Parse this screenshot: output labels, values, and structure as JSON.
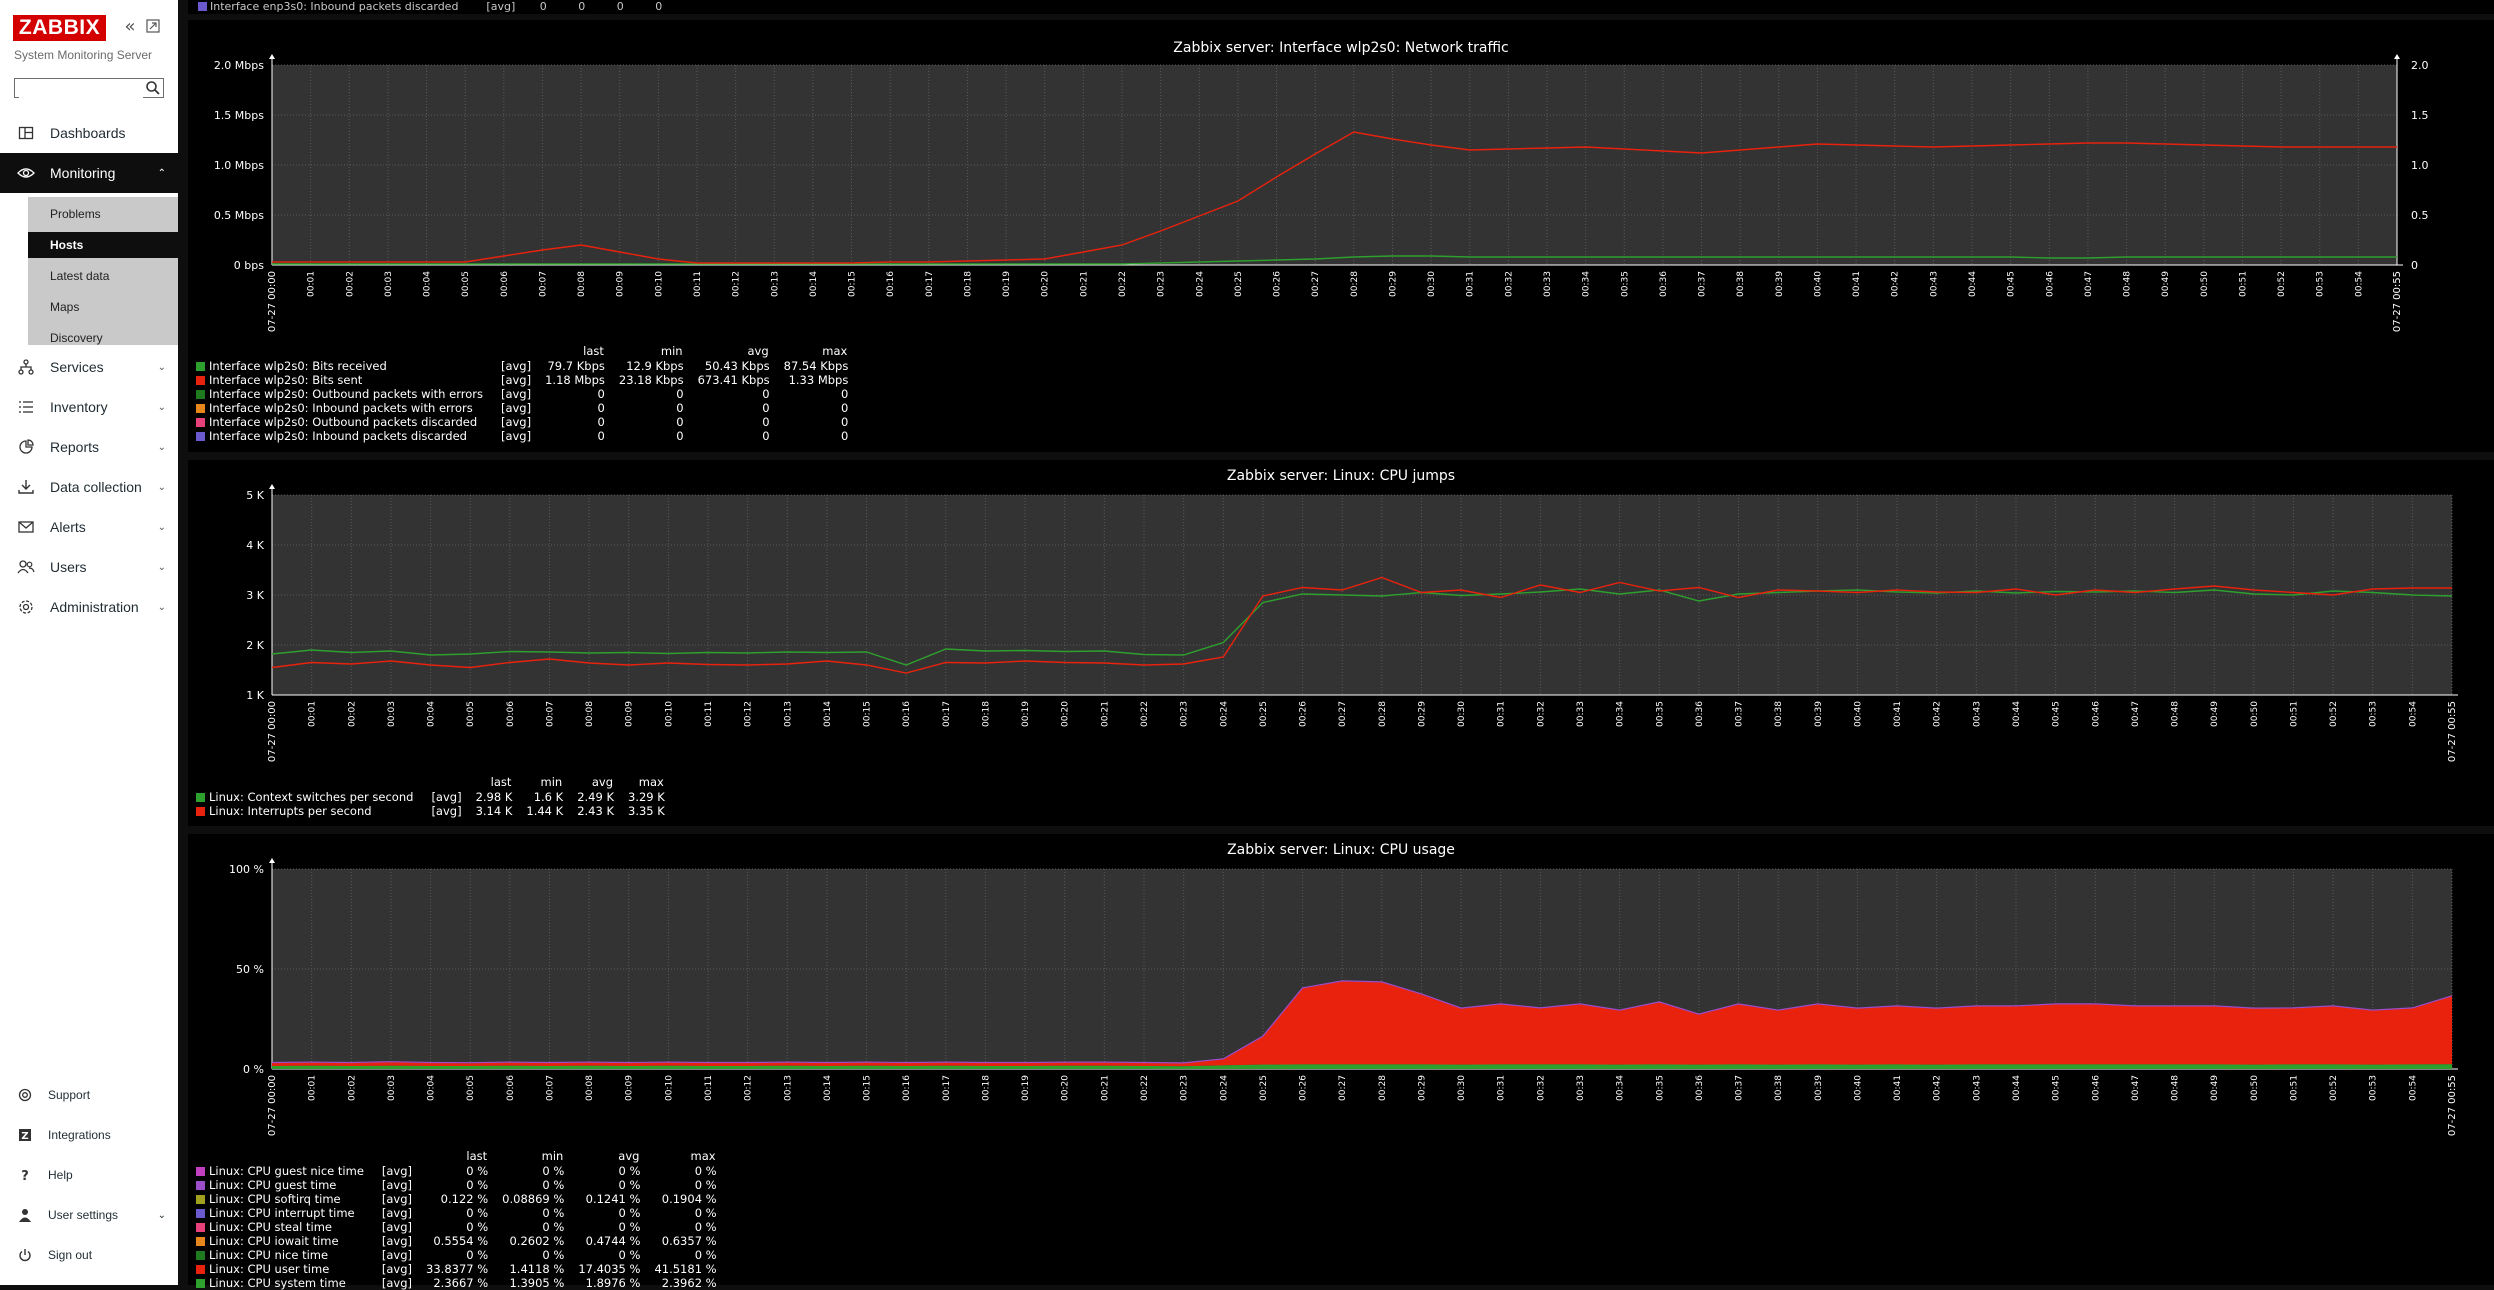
{
  "sidebar": {
    "logo": "ZABBIX",
    "server_name": "System Monitoring Server",
    "search_placeholder": "",
    "menu": [
      {
        "label": "Dashboards",
        "icon": "dashboard-icon"
      },
      {
        "label": "Monitoring",
        "icon": "eye-icon"
      },
      {
        "label": "Services",
        "icon": "services-icon"
      },
      {
        "label": "Inventory",
        "icon": "list-icon"
      },
      {
        "label": "Reports",
        "icon": "reports-icon"
      },
      {
        "label": "Data collection",
        "icon": "download-icon"
      },
      {
        "label": "Alerts",
        "icon": "envelope-icon"
      },
      {
        "label": "Users",
        "icon": "users-icon"
      },
      {
        "label": "Administration",
        "icon": "gear-icon"
      }
    ],
    "monitoring_sub": [
      "Problems",
      "Hosts",
      "Latest data",
      "Maps",
      "Discovery"
    ],
    "bottom": [
      {
        "label": "Support",
        "icon": "support-icon"
      },
      {
        "label": "Integrations",
        "icon": "integrations-icon"
      },
      {
        "label": "Help",
        "icon": "help-icon"
      },
      {
        "label": "User settings",
        "icon": "user-icon"
      },
      {
        "label": "Sign out",
        "icon": "power-icon"
      }
    ]
  },
  "top_strip": {
    "label": "Interface enp3s0: Inbound packets discarded",
    "func": "[avg]",
    "values": [
      "0",
      "0",
      "0",
      "0"
    ]
  },
  "colors": {
    "green": "#2ea02e",
    "red": "#e8220d",
    "dark_green": "#1f7a1f",
    "orange": "#e6861c",
    "pink": "#e8407a",
    "purple": "#6a5acd",
    "magenta": "#c040c0",
    "violet": "#9b4dca",
    "olive": "#a0a020"
  },
  "time_labels": [
    "07-27 00:00",
    "00:01",
    "00:02",
    "00:03",
    "00:04",
    "00:05",
    "00:06",
    "00:07",
    "00:08",
    "00:09",
    "00:10",
    "00:11",
    "00:12",
    "00:13",
    "00:14",
    "00:15",
    "00:16",
    "00:17",
    "00:18",
    "00:19",
    "00:20",
    "00:21",
    "00:22",
    "00:23",
    "00:24",
    "00:25",
    "00:26",
    "00:27",
    "00:28",
    "00:29",
    "00:30",
    "00:31",
    "00:32",
    "00:33",
    "00:34",
    "00:35",
    "00:36",
    "00:37",
    "00:38",
    "00:39",
    "00:40",
    "00:41",
    "00:42",
    "00:43",
    "00:44",
    "00:45",
    "00:46",
    "00:47",
    "00:48",
    "00:49",
    "00:50",
    "00:51",
    "00:52",
    "00:53",
    "00:54",
    "07-27 00:55"
  ],
  "legend_headers": {
    "last": "last",
    "min": "min",
    "avg": "avg",
    "max": "max"
  },
  "chart_data": [
    {
      "type": "line",
      "title": "Zabbix server: Interface wlp2s0: Network traffic",
      "y_ticks": [
        "0 bps",
        "0.5 Mbps",
        "1.0 Mbps",
        "1.5 Mbps",
        "2.0 Mbps"
      ],
      "y_ticks_right": [
        "0",
        "0.5",
        "1.0",
        "1.5",
        "2.0"
      ],
      "ylim": [
        0,
        2.0
      ],
      "series": [
        {
          "name": "Interface wlp2s0: Bits received",
          "color": "#2ea02e",
          "func": "[avg]",
          "last": "79.7 Kbps",
          "min": "12.9 Kbps",
          "avg": "50.43 Kbps",
          "max": "87.54 Kbps",
          "values": [
            0.01,
            0.01,
            0.01,
            0.01,
            0.01,
            0.01,
            0.01,
            0.01,
            0.01,
            0.01,
            0.01,
            0.01,
            0.01,
            0.01,
            0.01,
            0.01,
            0.01,
            0.01,
            0.01,
            0.01,
            0.01,
            0.01,
            0.01,
            0.02,
            0.03,
            0.04,
            0.05,
            0.06,
            0.08,
            0.09,
            0.09,
            0.08,
            0.08,
            0.08,
            0.08,
            0.08,
            0.08,
            0.08,
            0.08,
            0.08,
            0.08,
            0.08,
            0.08,
            0.08,
            0.08,
            0.08,
            0.07,
            0.07,
            0.08,
            0.08,
            0.08,
            0.08,
            0.08,
            0.08,
            0.08,
            0.08
          ]
        },
        {
          "name": "Interface wlp2s0: Bits sent",
          "color": "#e8220d",
          "func": "[avg]",
          "last": "1.18 Mbps",
          "min": "23.18 Kbps",
          "avg": "673.41 Kbps",
          "max": "1.33 Mbps",
          "values": [
            0.03,
            0.03,
            0.03,
            0.03,
            0.03,
            0.03,
            0.09,
            0.15,
            0.2,
            0.13,
            0.06,
            0.02,
            0.02,
            0.02,
            0.02,
            0.02,
            0.03,
            0.03,
            0.04,
            0.05,
            0.06,
            0.13,
            0.2,
            0.34,
            0.49,
            0.64,
            0.88,
            1.11,
            1.33,
            1.26,
            1.2,
            1.15,
            1.16,
            1.17,
            1.18,
            1.16,
            1.14,
            1.12,
            1.15,
            1.18,
            1.21,
            1.2,
            1.19,
            1.18,
            1.19,
            1.2,
            1.21,
            1.22,
            1.22,
            1.21,
            1.2,
            1.19,
            1.18,
            1.18,
            1.18,
            1.18
          ]
        },
        {
          "name": "Interface wlp2s0: Outbound packets with errors",
          "color": "#1f7a1f",
          "func": "[avg]",
          "last": "0",
          "min": "0",
          "avg": "0",
          "max": "0"
        },
        {
          "name": "Interface wlp2s0: Inbound packets with errors",
          "color": "#e6861c",
          "func": "[avg]",
          "last": "0",
          "min": "0",
          "avg": "0",
          "max": "0"
        },
        {
          "name": "Interface wlp2s0: Outbound packets discarded",
          "color": "#e8407a",
          "func": "[avg]",
          "last": "0",
          "min": "0",
          "avg": "0",
          "max": "0"
        },
        {
          "name": "Interface wlp2s0: Inbound packets discarded",
          "color": "#6a5acd",
          "func": "[avg]",
          "last": "0",
          "min": "0",
          "avg": "0",
          "max": "0"
        }
      ]
    },
    {
      "type": "line",
      "title": "Zabbix server: Linux: CPU jumps",
      "y_ticks": [
        "1 K",
        "2 K",
        "3 K",
        "4 K",
        "5 K"
      ],
      "ylim": [
        1000,
        5000
      ],
      "series": [
        {
          "name": "Linux: Context switches per second",
          "color": "#2ea02e",
          "func": "[avg]",
          "last": "2.98 K",
          "min": "1.6 K",
          "avg": "2.49 K",
          "max": "3.29 K",
          "values": [
            1820,
            1900,
            1850,
            1880,
            1800,
            1820,
            1870,
            1860,
            1840,
            1850,
            1830,
            1850,
            1840,
            1860,
            1850,
            1860,
            1600,
            1920,
            1880,
            1890,
            1870,
            1880,
            1810,
            1800,
            2050,
            2850,
            3020,
            3000,
            2980,
            3050,
            2990,
            3020,
            3060,
            3120,
            3020,
            3100,
            2880,
            3020,
            3050,
            3080,
            3100,
            3060,
            3040,
            3080,
            3040,
            3070,
            3060,
            3080,
            3050,
            3100,
            3020,
            3000,
            3080,
            3050,
            3000,
            2980
          ]
        },
        {
          "name": "Linux: Interrupts per second",
          "color": "#e8220d",
          "func": "[avg]",
          "last": "3.14 K",
          "min": "1.44 K",
          "avg": "2.43 K",
          "max": "3.35 K",
          "values": [
            1550,
            1650,
            1620,
            1680,
            1600,
            1550,
            1650,
            1720,
            1640,
            1600,
            1640,
            1610,
            1600,
            1620,
            1680,
            1600,
            1440,
            1650,
            1640,
            1680,
            1650,
            1640,
            1600,
            1620,
            1760,
            2980,
            3150,
            3100,
            3350,
            3050,
            3100,
            2950,
            3200,
            3050,
            3250,
            3080,
            3150,
            2950,
            3100,
            3080,
            3050,
            3100,
            3060,
            3050,
            3120,
            3000,
            3100,
            3050,
            3120,
            3180,
            3100,
            3050,
            3000,
            3120,
            3140,
            3140
          ]
        }
      ]
    },
    {
      "type": "area",
      "title": "Zabbix server: Linux: CPU usage",
      "y_ticks": [
        "0 %",
        "50 %",
        "100 %"
      ],
      "ylim": [
        0,
        100
      ],
      "series": [
        {
          "name": "Linux: CPU guest nice time",
          "color": "#c040c0",
          "func": "[avg]",
          "last": "0 %",
          "min": "0 %",
          "avg": "0 %",
          "max": "0 %"
        },
        {
          "name": "Linux: CPU guest time",
          "color": "#9b4dca",
          "func": "[avg]",
          "last": "0 %",
          "min": "0 %",
          "avg": "0 %",
          "max": "0 %"
        },
        {
          "name": "Linux: CPU softirq time",
          "color": "#a0a020",
          "func": "[avg]",
          "last": "0.122 %",
          "min": "0.08869 %",
          "avg": "0.1241 %",
          "max": "0.1904 %"
        },
        {
          "name": "Linux: CPU interrupt time",
          "color": "#6a5acd",
          "func": "[avg]",
          "last": "0 %",
          "min": "0 %",
          "avg": "0 %",
          "max": "0 %"
        },
        {
          "name": "Linux: CPU steal time",
          "color": "#e8407a",
          "func": "[avg]",
          "last": "0 %",
          "min": "0 %",
          "avg": "0 %",
          "max": "0 %"
        },
        {
          "name": "Linux: CPU iowait time",
          "color": "#e6861c",
          "func": "[avg]",
          "last": "0.5554 %",
          "min": "0.2602 %",
          "avg": "0.4744 %",
          "max": "0.6357 %"
        },
        {
          "name": "Linux: CPU nice time",
          "color": "#1f7a1f",
          "func": "[avg]",
          "last": "0 %",
          "min": "0 %",
          "avg": "0 %",
          "max": "0 %"
        },
        {
          "name": "Linux: CPU user time",
          "color": "#e8220d",
          "func": "[avg]",
          "last": "33.8377 %",
          "min": "1.4118 %",
          "avg": "17.4035 %",
          "max": "41.5181 %",
          "values": [
            1.5,
            1.6,
            1.5,
            1.8,
            1.5,
            1.4,
            1.6,
            1.5,
            1.6,
            1.5,
            1.6,
            1.5,
            1.5,
            1.6,
            1.5,
            1.6,
            1.5,
            1.6,
            1.5,
            1.5,
            1.6,
            1.6,
            1.5,
            1.4,
            3,
            14,
            38,
            41.5,
            41,
            35,
            28,
            30,
            28,
            30,
            27,
            31,
            25,
            30,
            27,
            30,
            28,
            29,
            28,
            29,
            29,
            30,
            30,
            29,
            29,
            29,
            28,
            28,
            29,
            27,
            28,
            34
          ]
        },
        {
          "name": "Linux: CPU system time",
          "color": "#2ea02e",
          "func": "[avg]",
          "last": "2.3667 %",
          "min": "1.3905 %",
          "avg": "1.8976 %",
          "max": "2.3962 %",
          "values": [
            1.5,
            1.6,
            1.5,
            1.6,
            1.5,
            1.5,
            1.6,
            1.5,
            1.6,
            1.5,
            1.6,
            1.5,
            1.5,
            1.6,
            1.5,
            1.6,
            1.5,
            1.6,
            1.5,
            1.5,
            1.6,
            1.6,
            1.5,
            1.4,
            1.8,
            2.2,
            2.3,
            2.3,
            2.3,
            2.3,
            2.2,
            2.3,
            2.3,
            2.3,
            2.2,
            2.3,
            2.2,
            2.3,
            2.2,
            2.3,
            2.2,
            2.3,
            2.2,
            2.3,
            2.3,
            2.3,
            2.3,
            2.3,
            2.3,
            2.3,
            2.2,
            2.3,
            2.3,
            2.2,
            2.3,
            2.37
          ]
        }
      ]
    }
  ]
}
